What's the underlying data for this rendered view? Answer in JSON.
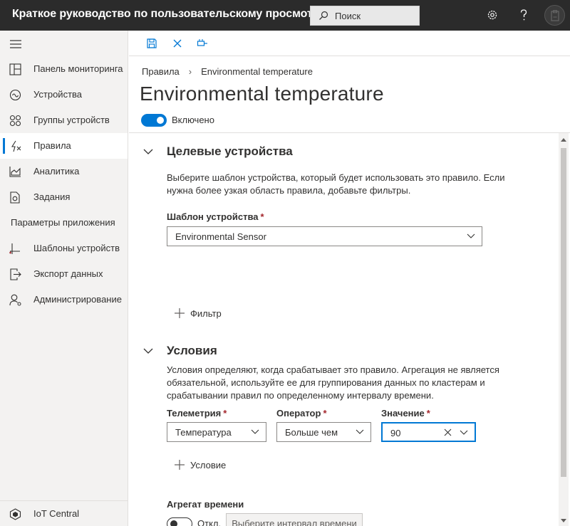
{
  "header": {
    "app_title": "Краткое руководство по пользовательскому просмотру",
    "search_placeholder": "Поиск",
    "icons": [
      "search-icon",
      "gear-icon",
      "help-icon",
      "user-avatar"
    ]
  },
  "sidebar": {
    "items": [
      {
        "label": "Панель мониторинга",
        "icon": "dashboard-icon"
      },
      {
        "label": "Устройства",
        "icon": "devices-icon"
      },
      {
        "label": "Группы устройств",
        "icon": "device-groups-icon"
      },
      {
        "label": "Правила",
        "icon": "rules-icon",
        "active": true
      },
      {
        "label": "Аналитика",
        "icon": "analytics-icon"
      },
      {
        "label": "Задания",
        "icon": "jobs-icon"
      }
    ],
    "section_label": "Параметры приложения",
    "settings_items": [
      {
        "label": "Шаблоны устройств",
        "icon": "device-templates-icon"
      },
      {
        "label": "Экспорт данных",
        "icon": "data-export-icon"
      },
      {
        "label": "Администрирование",
        "icon": "administration-icon"
      }
    ],
    "footer": {
      "label": "IoT Central",
      "icon": "iot-central-icon"
    }
  },
  "toolbar": {
    "icons": [
      "save-icon",
      "cancel-icon",
      "test-rule-icon"
    ]
  },
  "breadcrumb": {
    "root": "Правила",
    "current": "Environmental temperature"
  },
  "page": {
    "title": "Environmental temperature",
    "enabled_label": "Включено",
    "enabled": true
  },
  "target_devices": {
    "title": "Целевые устройства",
    "description": "Выберите шаблон устройства, который будет использовать это правило. Если нужна более узкая область правила, добавьте фильтры.",
    "template_label": "Шаблон устройства",
    "template_value": "Environmental Sensor",
    "add_filter_label": "Фильтр"
  },
  "conditions": {
    "title": "Условия",
    "description": "Условия определяют, когда срабатывает это правило. Агрегация не является обязательной, используйте ее для группирования данных по кластерам и срабатывании правил по определенному интервалу времени.",
    "telemetry_label": "Телеметрия",
    "telemetry_value": "Температура",
    "operator_label": "Оператор",
    "operator_value": "Больше чем",
    "value_label": "Значение",
    "value_value": "90",
    "add_condition_label": "Условие",
    "time_aggregation_label": "Агрегат времени",
    "time_aggregation_state": "Откл.",
    "time_aggregation_enabled": false,
    "select_interval_label": "Выберите интервал времени"
  },
  "required_marker": "*",
  "colors": {
    "topbar": "#2b2b2b",
    "accent": "#0078d4",
    "sidebar_bg": "#f3f2f1",
    "required": "#a4262c"
  }
}
